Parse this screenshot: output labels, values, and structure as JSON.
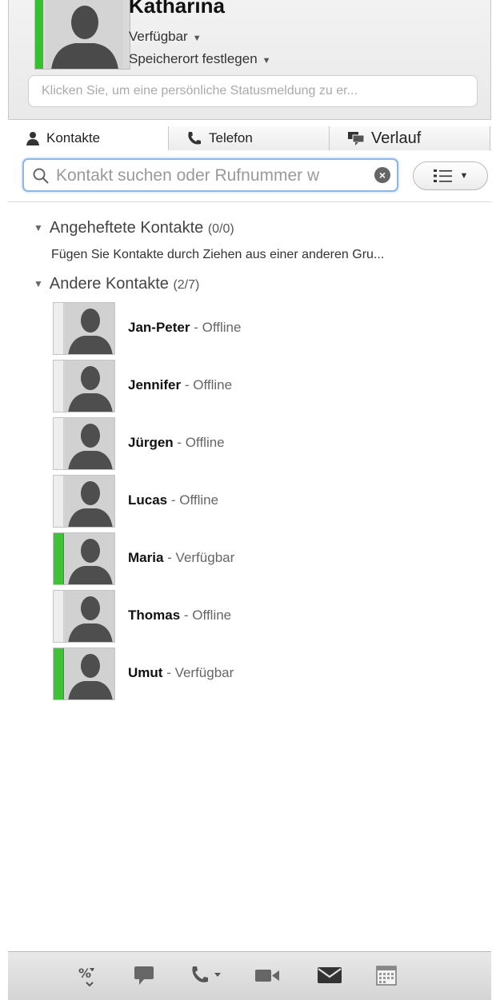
{
  "profile": {
    "name": "Katharina",
    "status": "Verfügbar",
    "location": "Speicherort festlegen",
    "status_message_placeholder": "Klicken Sie, um eine persönliche Statusmeldung zu er..."
  },
  "tabs": [
    {
      "label": "Kontakte",
      "icon": "person-icon",
      "active": true
    },
    {
      "label": "Telefon",
      "icon": "phone-icon",
      "active": false
    },
    {
      "label": "Verlauf",
      "icon": "chat-bubbles-icon",
      "active": false
    }
  ],
  "search": {
    "placeholder": "Kontakt suchen oder Rufnummer w"
  },
  "groups": {
    "pinned": {
      "label": "Angeheftete Kontakte",
      "count": "(0/0)",
      "hint": "Fügen Sie Kontakte durch Ziehen aus einer anderen Gru..."
    },
    "other": {
      "label": "Andere Kontakte",
      "count": "(2/7)"
    }
  },
  "contacts": [
    {
      "name": "Jan-Peter",
      "status": "- Offline",
      "online": false
    },
    {
      "name": "Jennifer",
      "status": "- Offline",
      "online": false
    },
    {
      "name": "Jürgen",
      "status": "- Offline",
      "online": false
    },
    {
      "name": "Lucas",
      "status": "- Offline",
      "online": false
    },
    {
      "name": "Maria",
      "status": "- Verfügbar",
      "online": true
    },
    {
      "name": "Thomas",
      "status": "- Offline",
      "online": false
    },
    {
      "name": "Umut",
      "status": "- Verfügbar",
      "online": true
    }
  ],
  "toolbar_icons": [
    "dialpad-icon",
    "chat-icon",
    "phone-dropdown-icon",
    "video-icon",
    "mail-icon",
    "calendar-icon"
  ],
  "colors": {
    "available": "#3fc238",
    "search_focus": "#8fb7e6"
  }
}
